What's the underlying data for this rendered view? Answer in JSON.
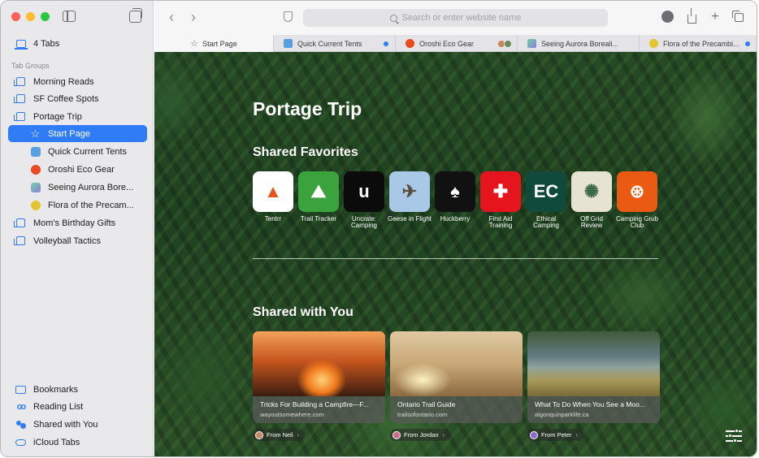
{
  "sidebar": {
    "tabs_label": "4 Tabs",
    "section_label": "Tab Groups",
    "groups": [
      {
        "label": "Morning Reads"
      },
      {
        "label": "SF Coffee Spots"
      },
      {
        "label": "Portage Trip"
      }
    ],
    "portage_tabs": [
      {
        "label": "Start Page",
        "icon": "star-icon"
      },
      {
        "label": "Quick Current Tents",
        "color": "#5aa0e0"
      },
      {
        "label": "Oroshi Eco Gear",
        "color": "#ea4a1f"
      },
      {
        "label": "Seeing Aurora Bore...",
        "color": "#8d7be0"
      },
      {
        "label": "Flora of the Precam...",
        "color": "#e3c531"
      }
    ],
    "more_groups": [
      {
        "label": "Mom's Birthday Gifts"
      },
      {
        "label": "Volleyball Tactics"
      }
    ],
    "bottom": [
      {
        "label": "Bookmarks",
        "icon": "book-icon"
      },
      {
        "label": "Reading List",
        "icon": "glasses-icon"
      },
      {
        "label": "Shared with You",
        "icon": "shared-icon"
      },
      {
        "label": "iCloud Tabs",
        "icon": "cloud-icon"
      }
    ]
  },
  "toolbar": {
    "address_placeholder": "Search or enter website name"
  },
  "tabs": [
    {
      "label": "Start Page"
    },
    {
      "label": "Quick Current Tents"
    },
    {
      "label": "Oroshi Eco Gear"
    },
    {
      "label": "Seeing Aurora Boreali..."
    },
    {
      "label": "Flora of the Precambi..."
    }
  ],
  "page": {
    "title": "Portage Trip",
    "favorites_heading": "Shared Favorites",
    "shared_heading": "Shared with You",
    "favorites": [
      {
        "name": "Tentrr",
        "bg": "#ffffff",
        "glyph": "▲",
        "fg": "#e8531e"
      },
      {
        "name": "Trail Tracker",
        "bg": "#3aa33e",
        "glyph": "⛰",
        "fg": "#ffffff"
      },
      {
        "name": "Uncrate: Camping",
        "bg": "#0b0b0b",
        "glyph": "u",
        "fg": "#ffffff"
      },
      {
        "name": "Geese in Flight",
        "bg": "#a9c8e8",
        "glyph": "✈",
        "fg": "#5a4a3a"
      },
      {
        "name": "Huckberry",
        "bg": "#111111",
        "glyph": "♠",
        "fg": "#ffffff"
      },
      {
        "name": "First Aid Training",
        "bg": "#e6141c",
        "glyph": "✚",
        "fg": "#ffffff"
      },
      {
        "name": "Ethical Camping",
        "bg": "#0f4a3c",
        "glyph": "EC",
        "fg": "#ffffff"
      },
      {
        "name": "Off Grid Review",
        "bg": "#e7e3d2",
        "glyph": "✺",
        "fg": "#3c6a4a"
      },
      {
        "name": "Camping Grub Club",
        "bg": "#ea5a12",
        "glyph": "⊛",
        "fg": "#ffffff"
      }
    ],
    "shared": [
      {
        "title": "Tricks For Building a Campfire—F...",
        "url": "wayoutsomewhere.com",
        "from": "From Neil",
        "avatar": "#c9875c"
      },
      {
        "title": "Ontario Trail Guide",
        "url": "trailsofontario.com",
        "from": "From Jordan",
        "avatar": "#d06a8a"
      },
      {
        "title": "What To Do When You See a Moo...",
        "url": "algonquinparklife.ca",
        "from": "From Peter",
        "avatar": "#8a6ad0"
      }
    ]
  }
}
